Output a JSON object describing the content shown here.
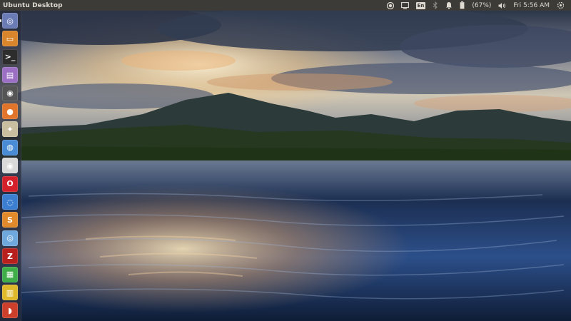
{
  "panel": {
    "title": "Ubuntu Desktop",
    "keyboard_layout": "En",
    "battery_text": "(67%)",
    "clock": "Fri 5:56 AM"
  },
  "indicators": [
    "media-record-icon",
    "display-icon",
    "keyboard-layout-indicator",
    "bluetooth-icon",
    "notification-bell-icon",
    "battery-icon",
    "volume-icon",
    "session-gear-icon"
  ],
  "launcher": {
    "items": [
      {
        "name": "ubuntu-dash-icon",
        "glyph": "◎",
        "color": "#6b7bb6"
      },
      {
        "name": "files-icon",
        "glyph": "▭",
        "color": "#d9852b"
      },
      {
        "name": "terminal-icon",
        "glyph": ">_",
        "color": "#2d2d2d"
      },
      {
        "name": "text-editor-icon",
        "glyph": "▤",
        "color": "#9b6fc4"
      },
      {
        "name": "disk-icon",
        "glyph": "◉",
        "color": "#555555"
      },
      {
        "name": "firefox-icon",
        "glyph": "●",
        "color": "#e0752b"
      },
      {
        "name": "compass-icon",
        "glyph": "✦",
        "color": "#c9bfa0"
      },
      {
        "name": "globe-icon",
        "glyph": "◍",
        "color": "#4a8bd6"
      },
      {
        "name": "chrome-icon",
        "glyph": "◉",
        "color": "#d9d9d9"
      },
      {
        "name": "opera-icon",
        "glyph": "O",
        "color": "#d3202a"
      },
      {
        "name": "browser-icon",
        "glyph": "◌",
        "color": "#3c7fd1"
      },
      {
        "name": "sublime-text-icon",
        "glyph": "S",
        "color": "#e08a2b"
      },
      {
        "name": "chromium-icon",
        "glyph": "◎",
        "color": "#6fa8dc"
      },
      {
        "name": "filezilla-icon",
        "glyph": "Z",
        "color": "#b8201e"
      },
      {
        "name": "spreadsheet-icon",
        "glyph": "▦",
        "color": "#3fae49"
      },
      {
        "name": "presentation-icon",
        "glyph": "▥",
        "color": "#e0b92b"
      },
      {
        "name": "software-center-icon",
        "glyph": "◗",
        "color": "#cc3f2a"
      }
    ]
  }
}
